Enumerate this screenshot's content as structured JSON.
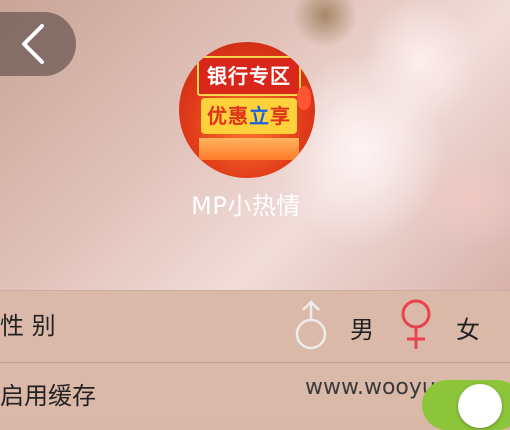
{
  "profile": {
    "nickname": "MP小热情",
    "avatar_text_top": "银行专区",
    "avatar_text_mid_a": "优惠",
    "avatar_text_mid_b": "立",
    "avatar_text_mid_c": "享"
  },
  "nav": {
    "back_icon": "chevron-left-icon"
  },
  "gender": {
    "label": "性 别",
    "male_label": "男",
    "female_label": "女",
    "male_icon": "male-symbol-icon",
    "female_icon": "female-symbol-icon",
    "male_color": "#e6e6e6",
    "female_color": "#e8434c"
  },
  "cache": {
    "label": "启用缓存",
    "toggle_on": true,
    "toggle_color": "#8cc43a"
  },
  "watermark": "www.wooyun.org"
}
